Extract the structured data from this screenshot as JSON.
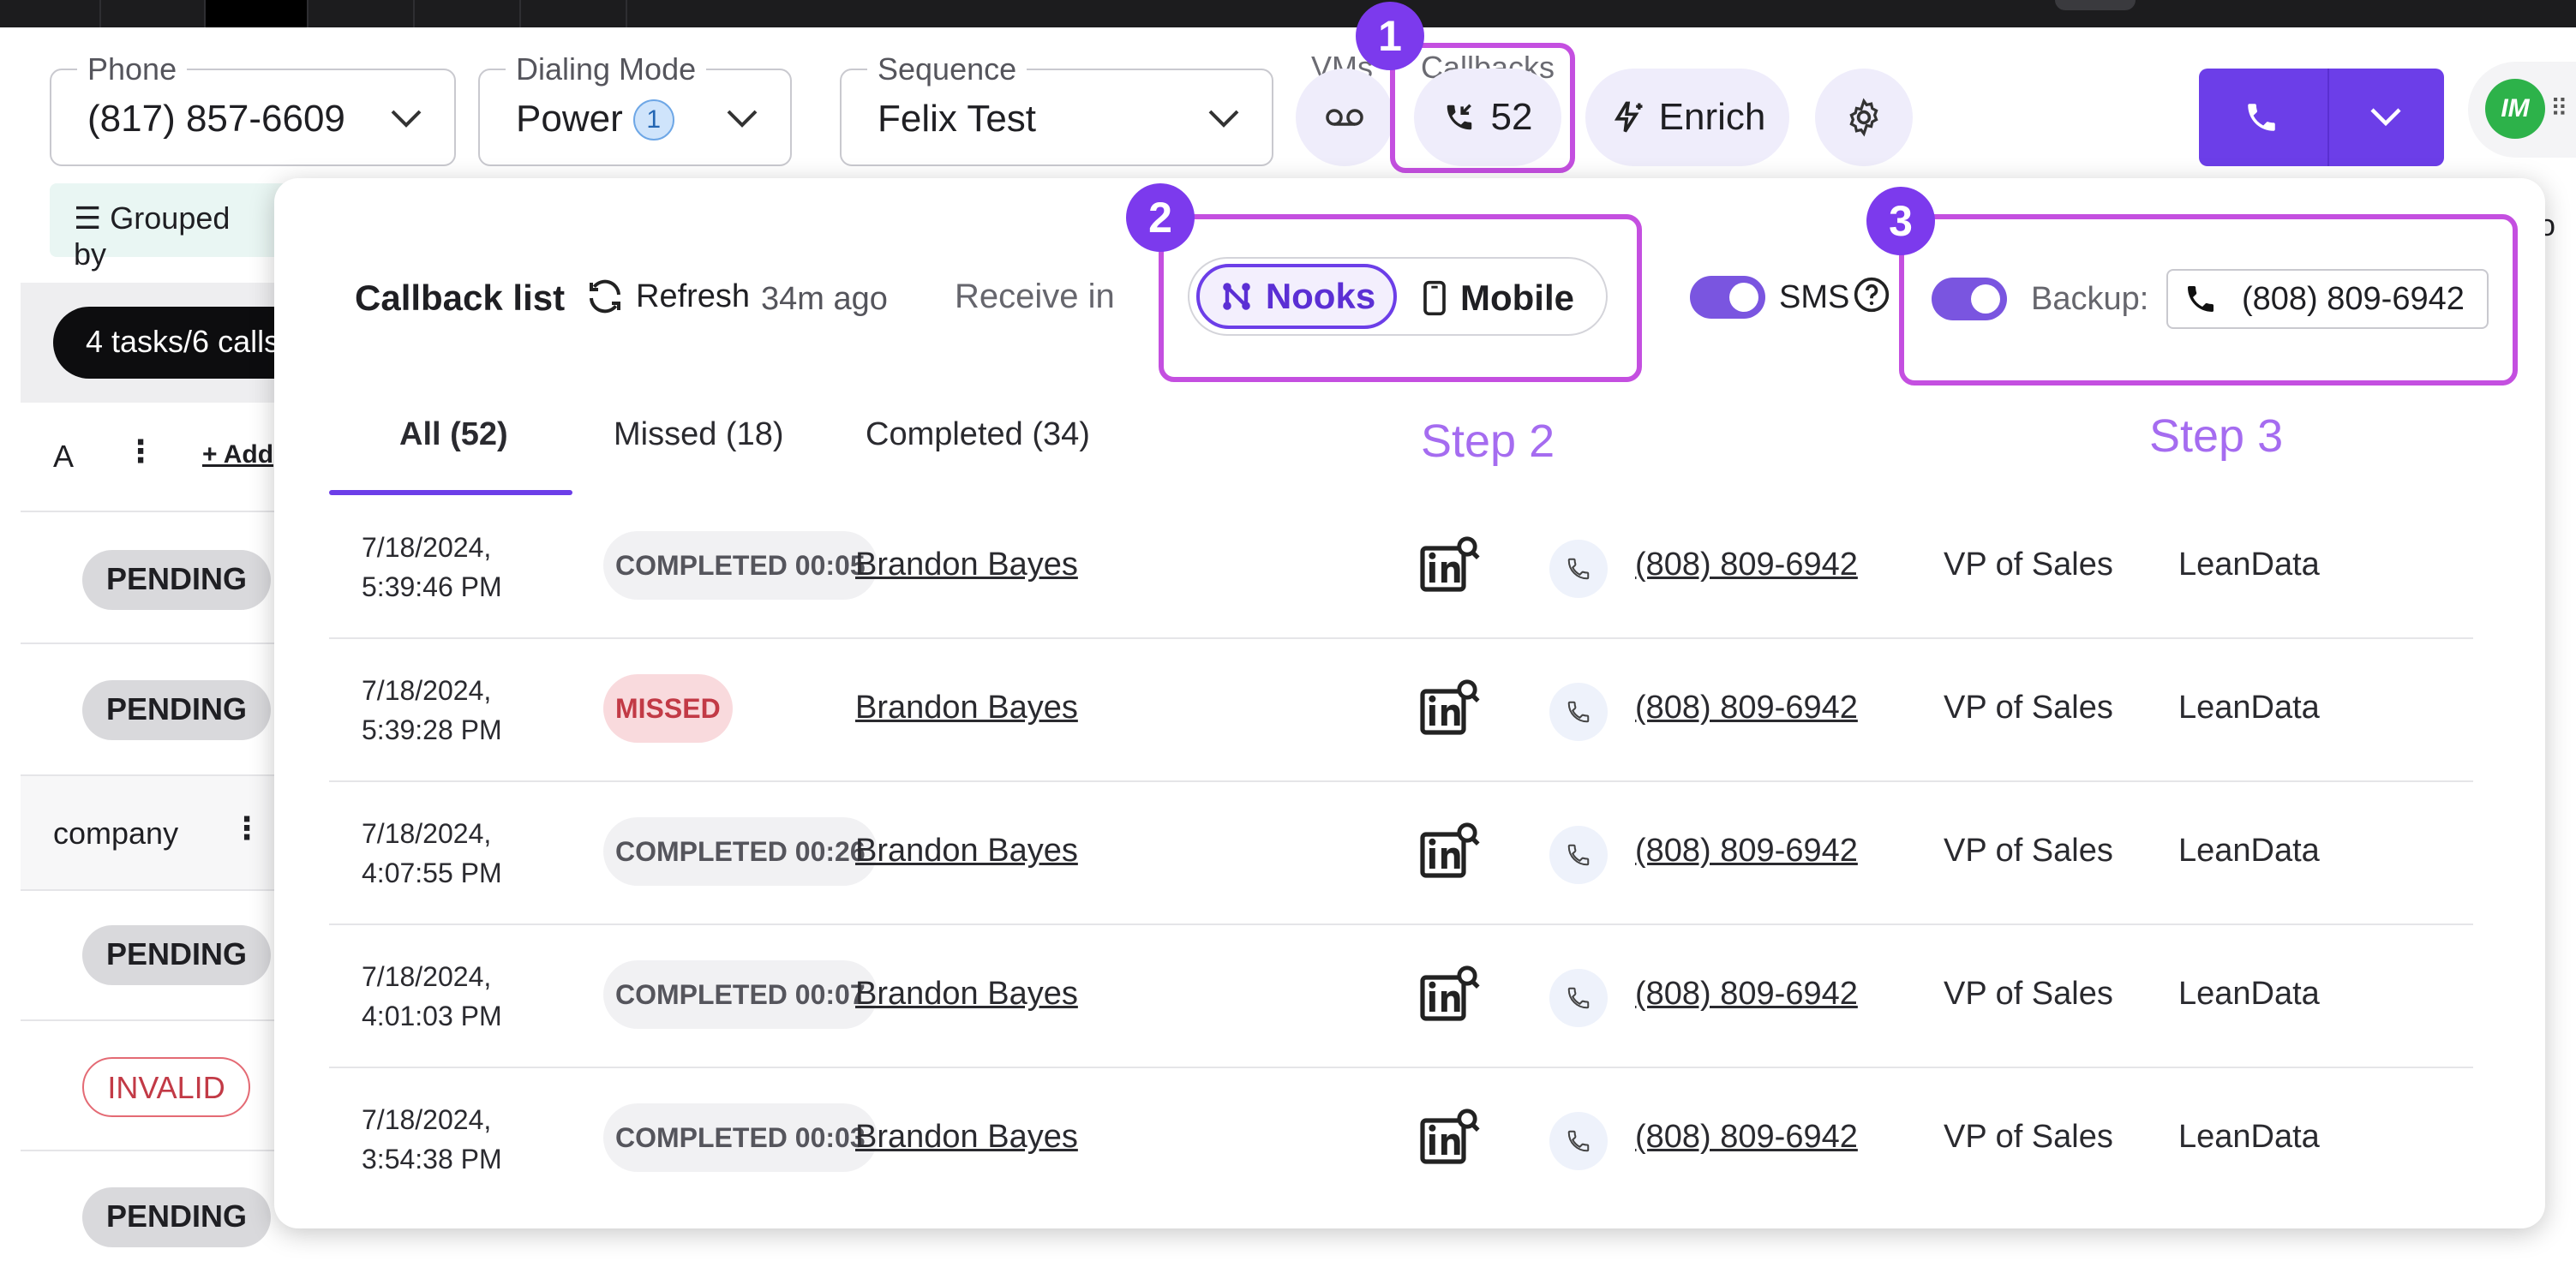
{
  "toolbar": {
    "phone": {
      "label": "Phone",
      "value": "(817) 857-6609"
    },
    "dialing_mode": {
      "label": "Dialing Mode",
      "value": "Power",
      "badge": "1"
    },
    "sequence": {
      "label": "Sequence",
      "value": "Felix Test"
    },
    "vms_label": "VMs",
    "callbacks": {
      "label": "Callbacks",
      "count": "52"
    },
    "enrich_label": "Enrich",
    "avatar_initials": "IM"
  },
  "background": {
    "grouped_by": "Grouped by",
    "tasks_pill": "4 tasks/6 calls",
    "col_a": "A",
    "add_col": "+ Add",
    "company_col": "company",
    "right_edge_text": "o",
    "statuses": [
      "PENDING",
      "PENDING",
      "PENDING",
      "INVALID",
      "PENDING"
    ]
  },
  "steps": {
    "step1_num": "1",
    "step2_num": "2",
    "step3_num": "3",
    "step2_label": "Step 2",
    "step3_label": "Step 3"
  },
  "panel": {
    "title": "Callback list",
    "refresh_label": "Refresh",
    "last_updated": "34m ago",
    "receive_in_label": "Receive in",
    "nooks_label": "Nooks",
    "mobile_label": "Mobile",
    "sms_label": "SMS",
    "backup_label": "Backup:",
    "backup_number": "(808) 809-6942",
    "tabs": [
      {
        "label": "All (52)"
      },
      {
        "label": "Missed (18)"
      },
      {
        "label": "Completed (34)"
      }
    ],
    "rows": [
      {
        "date": "7/18/2024,",
        "time": "5:39:46 PM",
        "status": "COMPLETED 00:05",
        "kind": "completed",
        "name": "Brandon Bayes",
        "phone": "(808) 809-6942",
        "title": "VP of Sales",
        "company": "LeanData"
      },
      {
        "date": "7/18/2024,",
        "time": "5:39:28 PM",
        "status": "MISSED",
        "kind": "missed",
        "name": "Brandon Bayes",
        "phone": "(808) 809-6942",
        "title": "VP of Sales",
        "company": "LeanData"
      },
      {
        "date": "7/18/2024,",
        "time": "4:07:55 PM",
        "status": "COMPLETED 00:26",
        "kind": "completed",
        "name": "Brandon Bayes",
        "phone": "(808) 809-6942",
        "title": "VP of Sales",
        "company": "LeanData"
      },
      {
        "date": "7/18/2024,",
        "time": "4:01:03 PM",
        "status": "COMPLETED 00:07",
        "kind": "completed",
        "name": "Brandon Bayes",
        "phone": "(808) 809-6942",
        "title": "VP of Sales",
        "company": "LeanData"
      },
      {
        "date": "7/18/2024,",
        "time": "3:54:38 PM",
        "status": "COMPLETED 00:03",
        "kind": "completed",
        "name": "Brandon Bayes",
        "phone": "(808) 809-6942",
        "title": "VP of Sales",
        "company": "LeanData"
      }
    ]
  },
  "colors": {
    "accent": "#6c3ee8",
    "highlight": "#c44fe0",
    "step_label": "#a56cf0",
    "missed": "#c23a46"
  }
}
